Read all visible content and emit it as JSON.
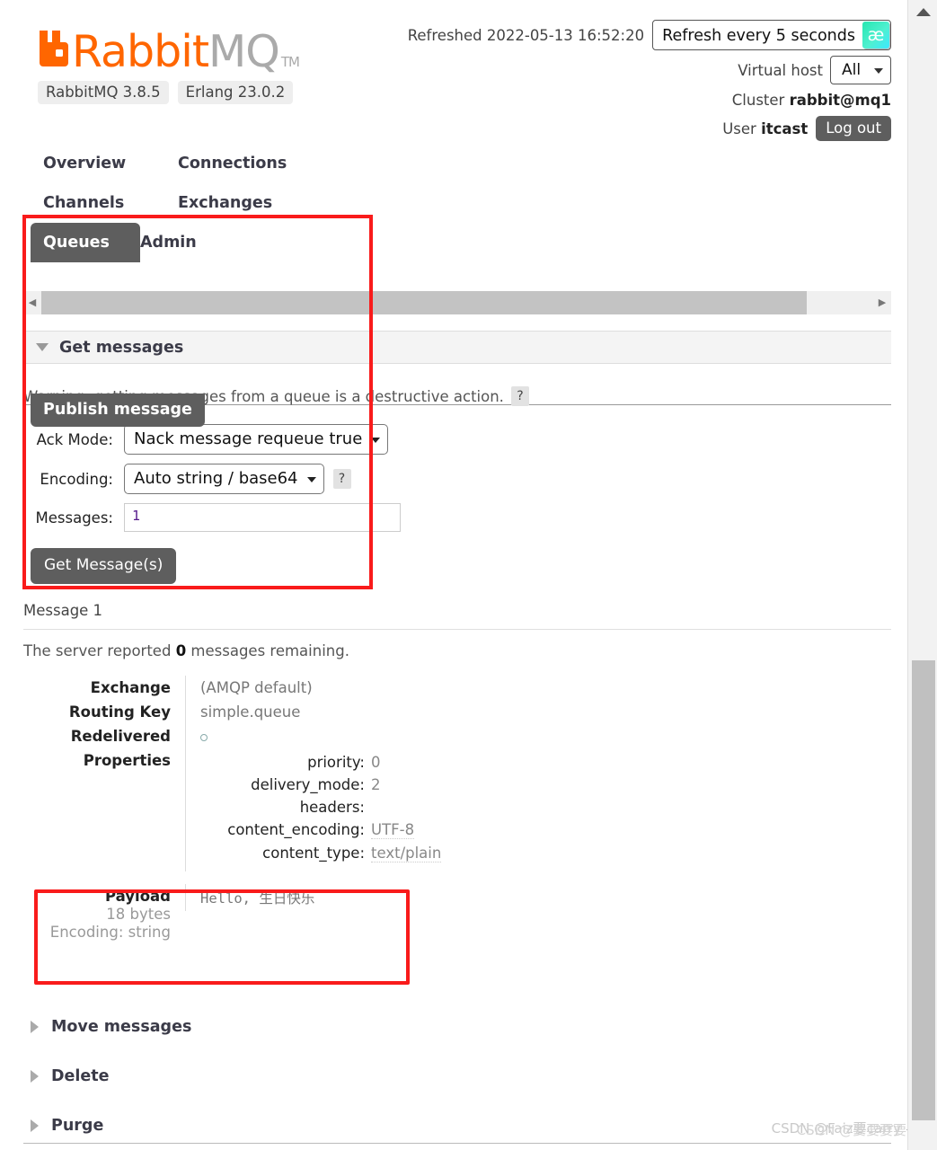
{
  "header": {
    "logo": {
      "brand_part1": "Rabbit",
      "brand_part2": "MQ",
      "trademark": "TM",
      "icon": "rabbit-logo-icon"
    },
    "version_pills": [
      "RabbitMQ 3.8.5",
      "Erlang 23.0.2"
    ],
    "refreshed_text": "Refreshed 2022-05-13 16:52:20",
    "refresh_interval_label": "Refresh every 5 seconds",
    "ime_icon_glyph": "æ",
    "vhost_label": "Virtual host",
    "vhost_value": "All",
    "cluster_label": "Cluster",
    "cluster_value": "rabbit@mq1",
    "user_label": "User",
    "user_value": "itcast",
    "logout_label": "Log out"
  },
  "nav": {
    "row1": [
      "Overview",
      "Connections"
    ],
    "row2": [
      "Channels",
      "Exchanges"
    ],
    "row3": [
      "Queues",
      "Admin"
    ],
    "active_tab": "Queues",
    "publish_button": "Publish message"
  },
  "get_messages": {
    "section_title": "Get messages",
    "warning": "Warning: getting messages from a queue is a destructive action.",
    "help_glyph": "?",
    "ack_mode_label": "Ack Mode:",
    "ack_mode_value": "Nack message requeue true",
    "encoding_label": "Encoding:",
    "encoding_value": "Auto string / base64",
    "encoding_help_glyph": "?",
    "messages_label": "Messages:",
    "messages_value": "1",
    "get_button": "Get Message(s)"
  },
  "message": {
    "title": "Message 1",
    "report_prefix": "The server reported",
    "report_count": "0",
    "report_suffix": "messages remaining.",
    "rows": [
      {
        "key": "Exchange",
        "value": "(AMQP default)"
      },
      {
        "key": "Routing Key",
        "value": "simple.queue"
      },
      {
        "key": "Redelivered",
        "value": "○"
      }
    ],
    "properties_key": "Properties",
    "properties": [
      {
        "name": "priority:",
        "value": "0"
      },
      {
        "name": "delivery_mode:",
        "value": "2"
      },
      {
        "name": "headers:",
        "value": ""
      },
      {
        "name": "content_encoding:",
        "value": "UTF-8"
      },
      {
        "name": "content_type:",
        "value": "text/plain"
      }
    ],
    "payload_key": "Payload",
    "payload_size": "18 bytes",
    "payload_encoding": "Encoding: string",
    "payload_body": "Hello, 生日快乐"
  },
  "collapsed_sections": [
    {
      "label": "Move messages"
    },
    {
      "label": "Delete"
    },
    {
      "label": "Purge"
    }
  ],
  "scrollbars": {
    "h_left_arrow": "◀",
    "h_right_arrow": "▶"
  },
  "watermark": {
    "line1": "CSDN @Faiz要carry",
    "line2": "CSDN @要要要要"
  },
  "colors": {
    "brand_orange": "#ff6600",
    "accent_gray": "#5e5e5e",
    "annotation_red": "#f91b1b",
    "ime_teal": "#27e6b0"
  }
}
